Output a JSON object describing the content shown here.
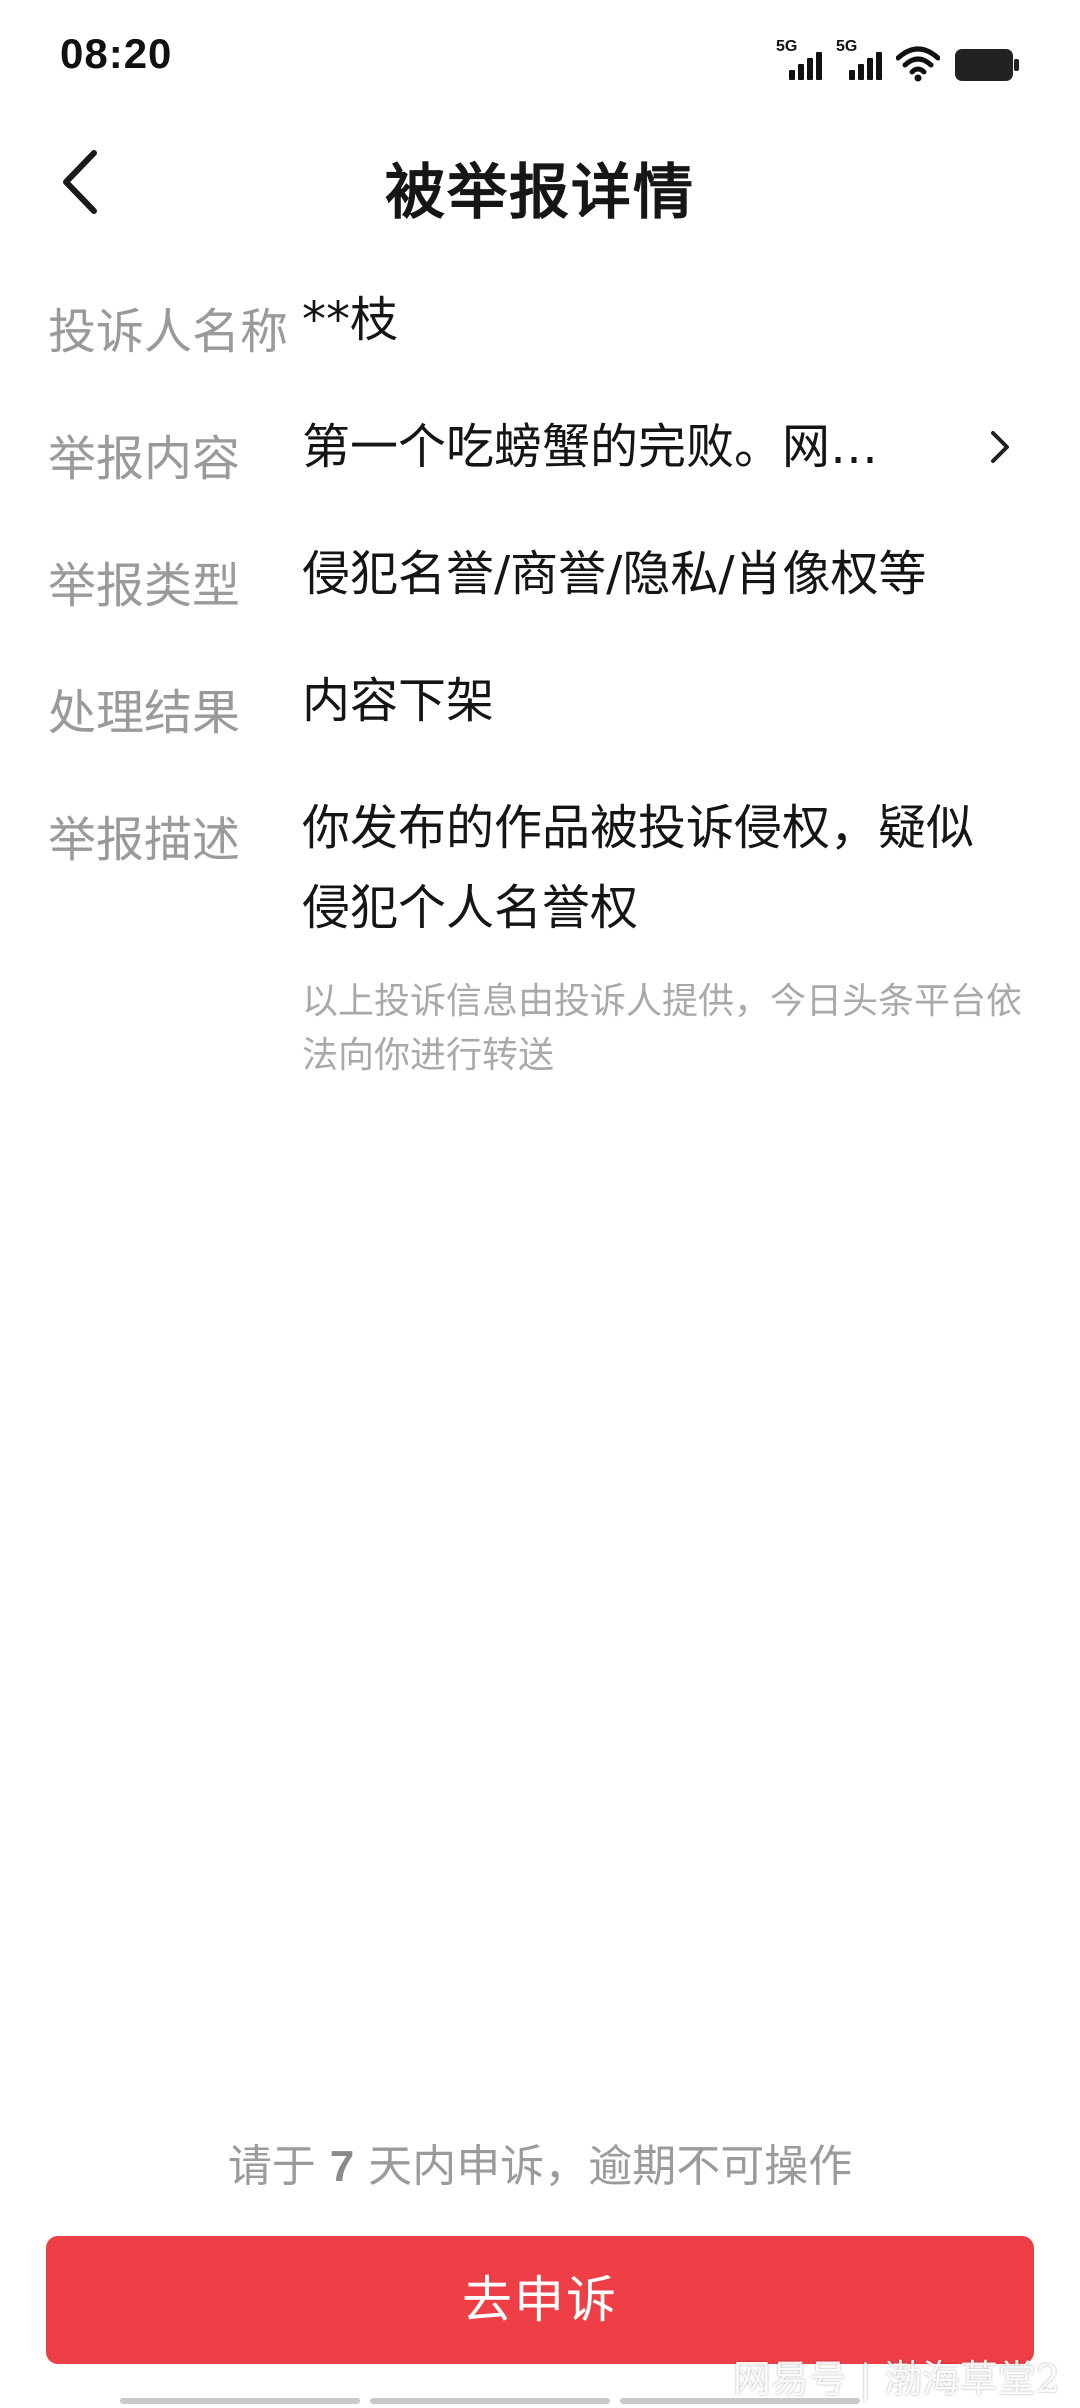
{
  "status_bar": {
    "time": "08:20",
    "sim1_label": "5G",
    "sim2_label": "5G",
    "icons": [
      "signal-5g-icon",
      "signal-5g-icon",
      "wifi-icon",
      "battery-icon"
    ]
  },
  "nav": {
    "back_icon": "chevron-left-icon",
    "title": "被举报详情"
  },
  "details": {
    "rows": [
      {
        "label": "投诉人名称",
        "value": "**枝"
      },
      {
        "label": "举报内容",
        "value": "第一个吃螃蟹的完败。网…"
      },
      {
        "label": "举报类型",
        "value": "侵犯名誉/商誉/隐私/肖像权等"
      },
      {
        "label": "处理结果",
        "value": "内容下架"
      },
      {
        "label": "举报描述",
        "value": "你发布的作品被投诉侵权，疑似侵犯个人名誉权"
      }
    ],
    "content_chevron_icon": "chevron-right-icon",
    "note": "以上投诉信息由投诉人提供，今日头条平台依法向你进行转送"
  },
  "footer": {
    "deadline_prefix": "请于 ",
    "deadline_days": "7",
    "deadline_suffix": " 天内申诉，逾期不可操作",
    "appeal_button": "去申诉",
    "watermark": "网易号 | 渤海草堂2"
  },
  "colors": {
    "accent": "#ef3f46",
    "label_gray": "#9a9a9a",
    "text_dark": "#151515"
  }
}
